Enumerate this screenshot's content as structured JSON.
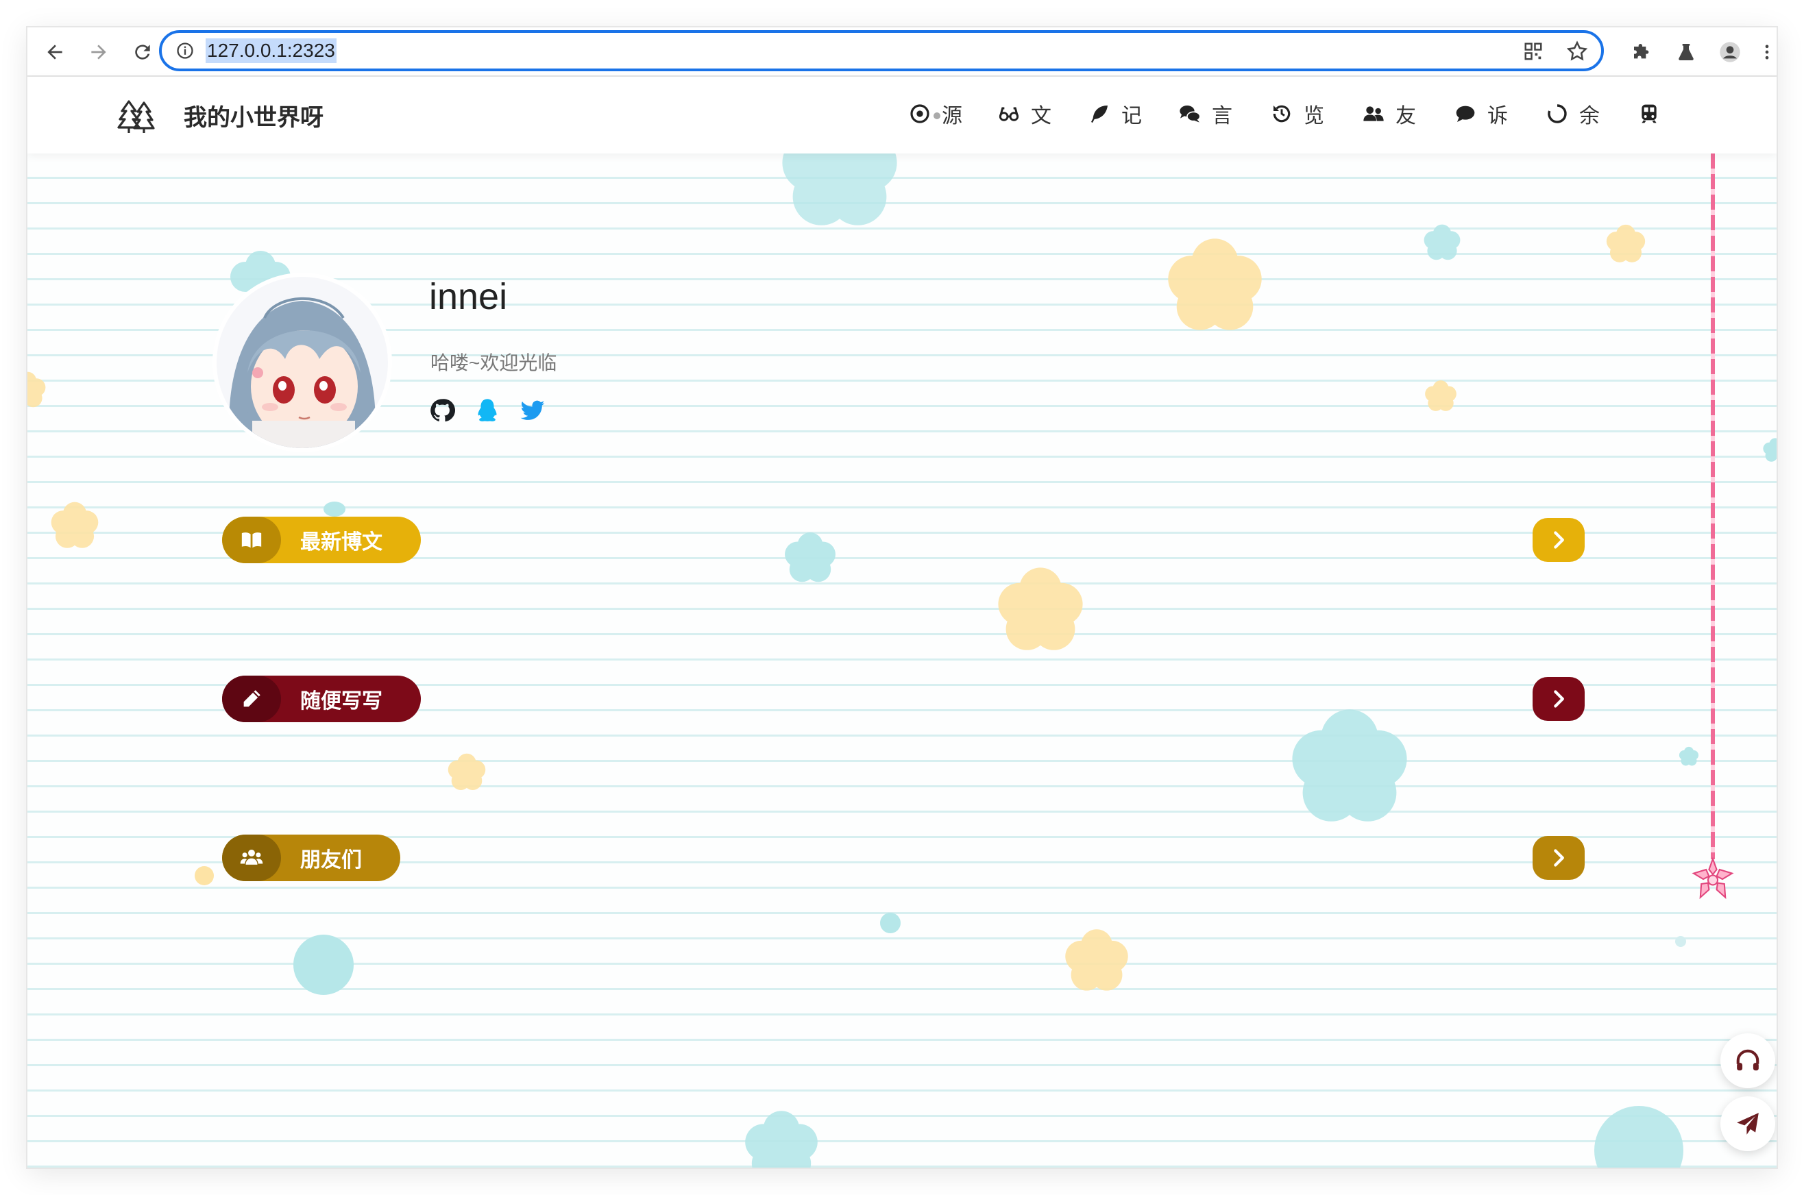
{
  "browser": {
    "url": "127.0.0.1:2323",
    "icons": [
      "back-icon",
      "forward-icon",
      "reload-icon",
      "info-icon",
      "qr-code-icon",
      "bookmark-star-icon",
      "extensions-icon",
      "labs-flask-icon",
      "profile-icon",
      "menu-dots-icon"
    ]
  },
  "site": {
    "title": "我的小世界呀",
    "nav": [
      {
        "icon": "target-icon",
        "label": "源"
      },
      {
        "icon": "glasses-icon",
        "label": "文"
      },
      {
        "icon": "feather-icon",
        "label": "记"
      },
      {
        "icon": "comments-icon",
        "label": "言"
      },
      {
        "icon": "history-icon",
        "label": "览"
      },
      {
        "icon": "users-icon",
        "label": "友"
      },
      {
        "icon": "comment-icon",
        "label": "诉"
      },
      {
        "icon": "loading-circle-icon",
        "label": "余"
      },
      {
        "icon": "train-icon",
        "label": ""
      }
    ]
  },
  "profile": {
    "name": "innei",
    "greeting": "哈喽~欢迎光临",
    "social": [
      "github-icon",
      "qq-icon",
      "twitter-icon"
    ]
  },
  "sections": [
    {
      "label": "最新博文",
      "icon": "book-icon",
      "color": "#e6b10a",
      "dark": "#b98a05"
    },
    {
      "label": "随便写写",
      "icon": "pencil-icon",
      "color": "#7d0a18",
      "dark": "#5e0612"
    },
    {
      "label": "朋友们",
      "icon": "users-icon",
      "color": "#b7860a",
      "dark": "#8a6406"
    }
  ],
  "colors": {
    "accent_blue": "#1a73e8",
    "flower_cyan": "#b6e7e9",
    "flower_yellow": "#fde3a5",
    "thread_pink": "#f06b97"
  },
  "fabs": [
    "headphones-icon",
    "send-plane-icon"
  ]
}
